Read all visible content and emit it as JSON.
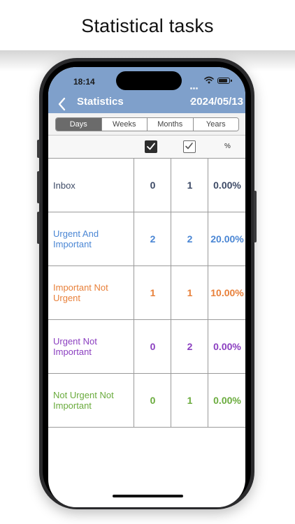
{
  "caption": "Statistical tasks",
  "status_bar": {
    "time": "18:14"
  },
  "nav": {
    "title": "Statistics",
    "date": "2024/05/13"
  },
  "segments": [
    "Days",
    "Weeks",
    "Months",
    "Years"
  ],
  "header": {
    "percent_label": "%"
  },
  "rows": [
    {
      "label": "Inbox",
      "v1": "0",
      "v2": "1",
      "pct": "0.00%",
      "color": "#3d4a66"
    },
    {
      "label": "Urgent And Important",
      "v1": "2",
      "v2": "2",
      "pct": "20.00%",
      "color": "#4a86d4"
    },
    {
      "label": "Important Not Urgent",
      "v1": "1",
      "v2": "1",
      "pct": "10.00%",
      "color": "#e8803a"
    },
    {
      "label": "Urgent Not Important",
      "v1": "0",
      "v2": "2",
      "pct": "0.00%",
      "color": "#8b3fc0"
    },
    {
      "label": "Not Urgent Not Important",
      "v1": "0",
      "v2": "1",
      "pct": "0.00%",
      "color": "#6aab3d"
    }
  ]
}
